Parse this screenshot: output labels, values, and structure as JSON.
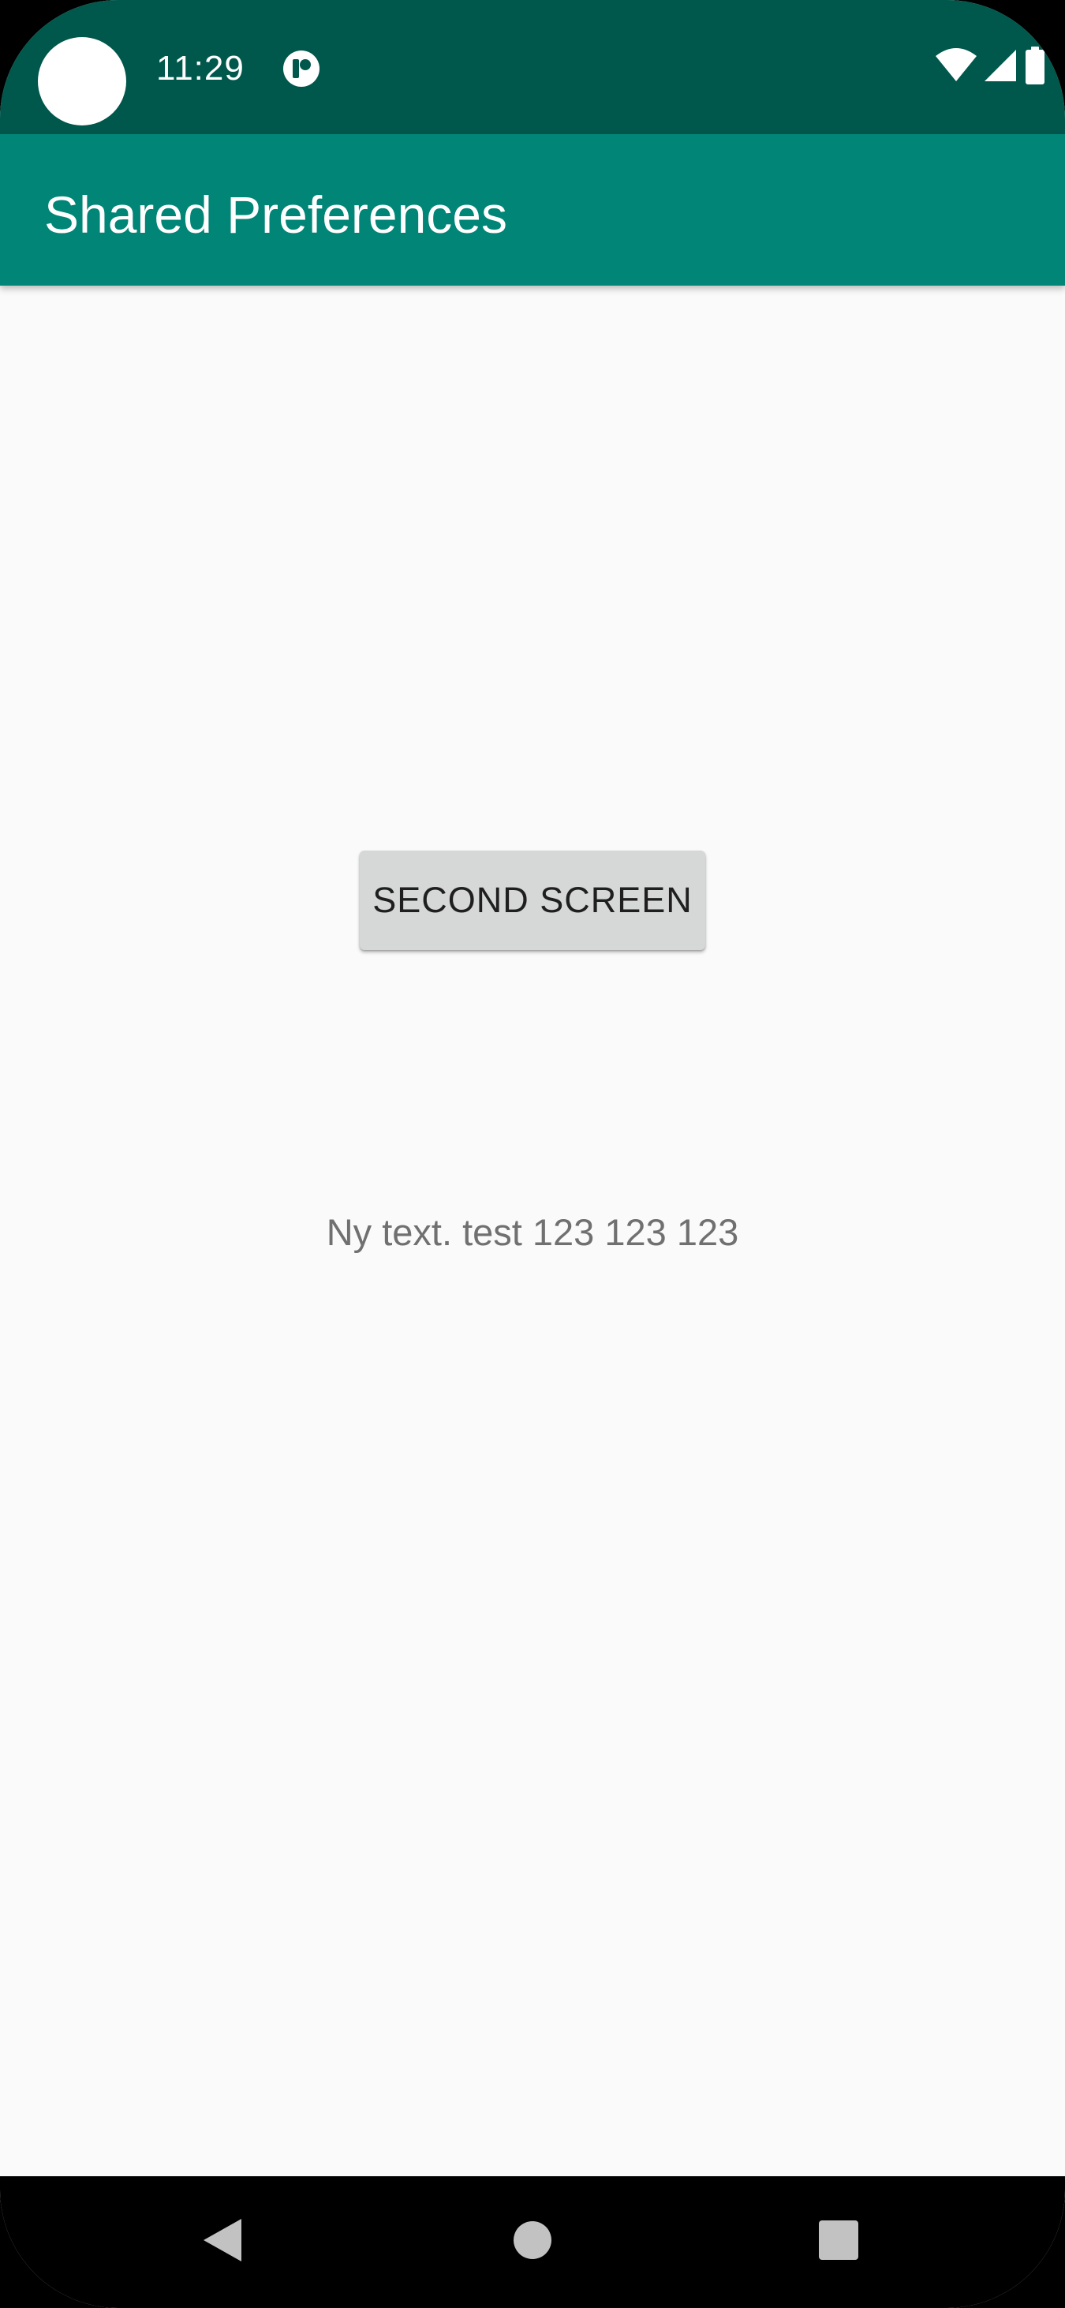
{
  "status_bar": {
    "time": "11:29",
    "app_notification_icon": "pinned-app-icon",
    "wifi_icon": "wifi-icon",
    "signal_icon": "cell-signal-icon",
    "battery_icon": "battery-icon",
    "background_color": "#00574b"
  },
  "app_bar": {
    "title": "Shared Preferences",
    "background_color": "#008577"
  },
  "main": {
    "second_screen_button_label": "SECOND SCREEN",
    "saved_text": "Ny text. test 123 123 123"
  },
  "nav_bar": {
    "back_icon": "back-triangle-icon",
    "home_icon": "home-circle-icon",
    "recents_icon": "recents-square-icon"
  }
}
